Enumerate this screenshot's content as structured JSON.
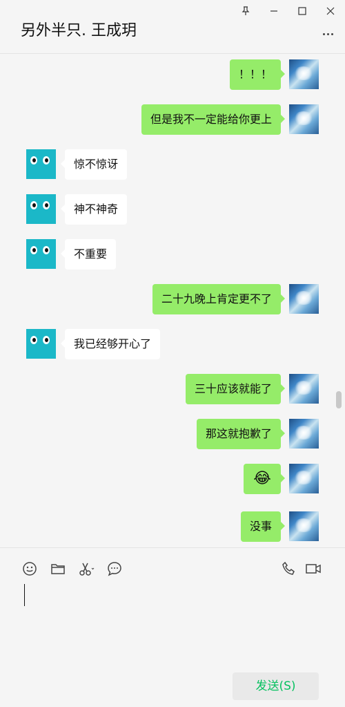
{
  "header": {
    "title": "另外半只. 王成玥",
    "window_controls": [
      "pin-icon",
      "minimize-icon",
      "maximize-icon",
      "close-icon"
    ],
    "more_icon": "more-icon"
  },
  "messages": [
    {
      "side": "right",
      "text": "！！！"
    },
    {
      "side": "right",
      "text": "但是我不一定能给你更上"
    },
    {
      "side": "left",
      "text": "惊不惊讶"
    },
    {
      "side": "left",
      "text": "神不神奇"
    },
    {
      "side": "left",
      "text": "不重要"
    },
    {
      "side": "right",
      "text": "二十九晚上肯定更不了"
    },
    {
      "side": "left",
      "text": "我已经够开心了"
    },
    {
      "side": "right",
      "text": "三十应该就能了"
    },
    {
      "side": "right",
      "text": "那这就抱歉了"
    },
    {
      "side": "right",
      "text": "😂"
    },
    {
      "side": "right",
      "text": "没事"
    }
  ],
  "toolbar": {
    "icons": [
      "emoji-icon",
      "folder-icon",
      "scissors-icon",
      "chat-history-icon",
      "phone-icon",
      "video-icon"
    ]
  },
  "input": {
    "value": ""
  },
  "send_button": {
    "label": "发送(S)"
  },
  "colors": {
    "self_bubble": "#95ec69",
    "friend_bubble": "#ffffff",
    "send_text": "#07c160",
    "friend_avatar": "#1bb8c8"
  }
}
